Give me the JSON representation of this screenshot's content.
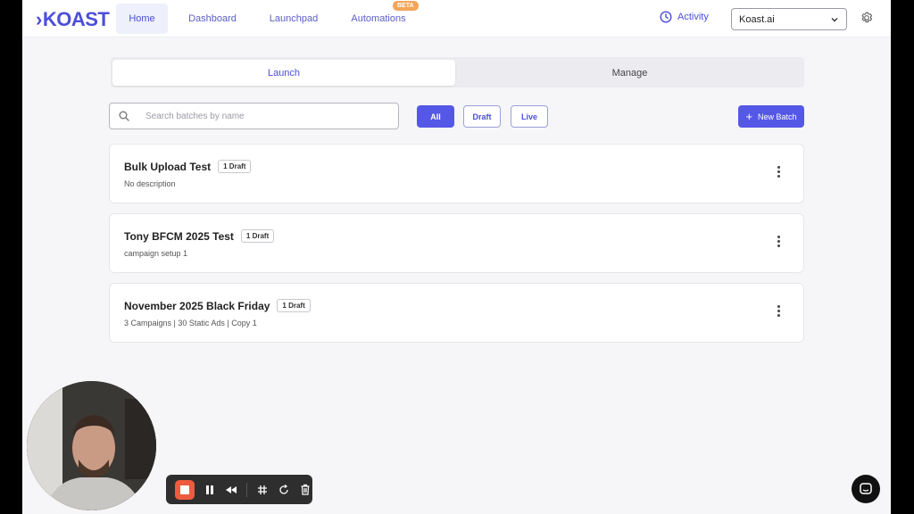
{
  "brand": {
    "logo_text": "KOAST",
    "accent": "#5558e6"
  },
  "nav": {
    "items": [
      {
        "label": "Home",
        "active": true
      },
      {
        "label": "Dashboard"
      },
      {
        "label": "Launchpad"
      },
      {
        "label": "Automations"
      }
    ],
    "beta_badge": "BETA",
    "activity_label": "Activity",
    "org_select_value": "Koast.ai"
  },
  "tabs": [
    {
      "label": "Launch",
      "active": true
    },
    {
      "label": "Manage"
    }
  ],
  "search": {
    "placeholder": "Search batches by name",
    "value": ""
  },
  "filters": [
    {
      "label": "All",
      "active": true
    },
    {
      "label": "Draft"
    },
    {
      "label": "Live"
    }
  ],
  "new_batch_label": "New Batch",
  "batches": [
    {
      "title": "Bulk Upload Test",
      "badge": "1 Draft",
      "description": "No description"
    },
    {
      "title": "Tony BFCM 2025 Test",
      "badge": "1 Draft",
      "description": "campaign setup 1"
    },
    {
      "title": "November 2025 Black Friday",
      "badge": "1 Draft",
      "description": "3 Campaigns | 30 Static Ads | Copy 1"
    }
  ]
}
